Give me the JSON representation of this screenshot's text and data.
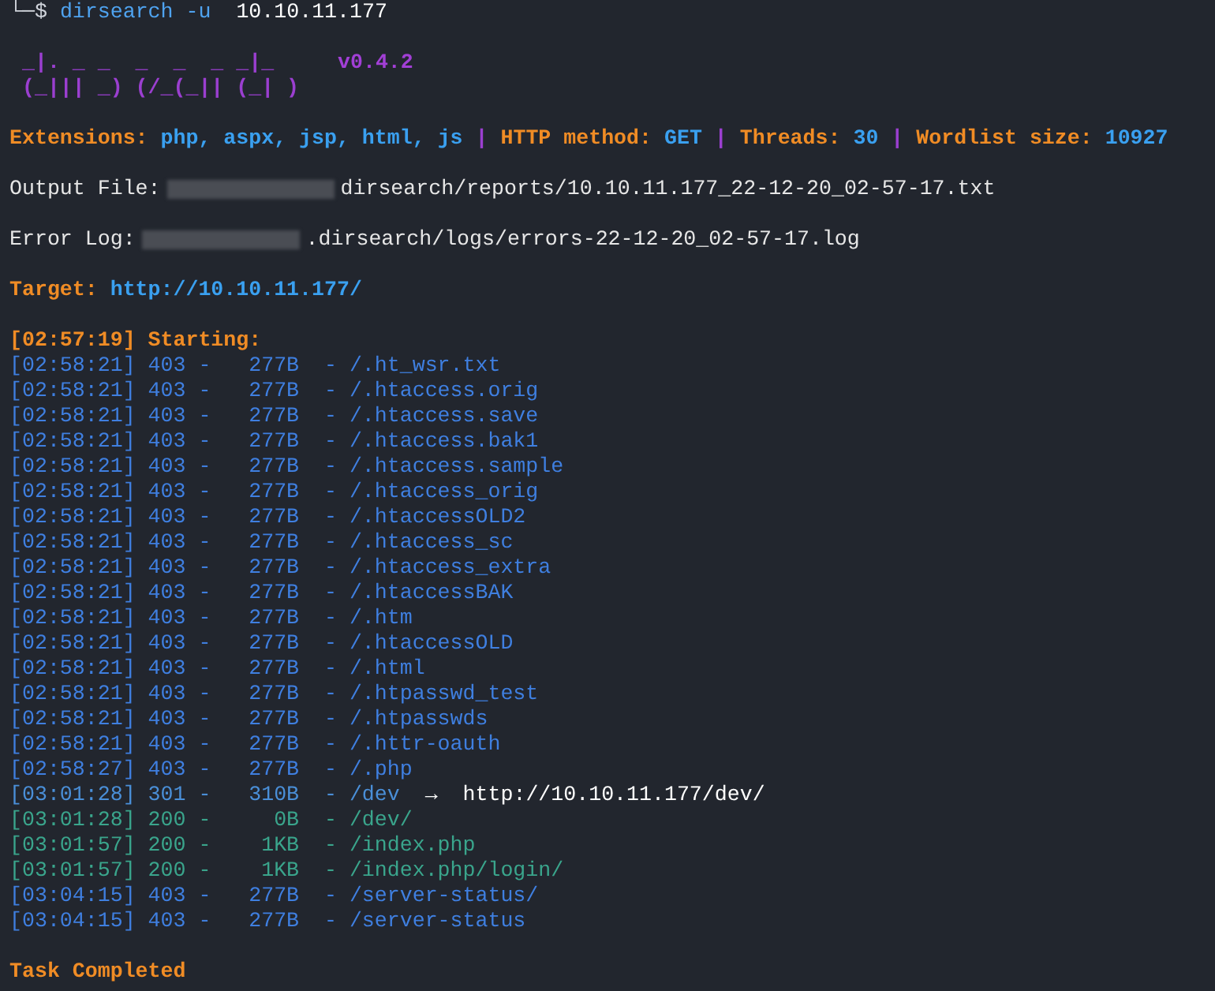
{
  "prompt": {
    "symbol": "└─$",
    "command": "dirsearch",
    "flag": "-u",
    "target": "10.10.11.177"
  },
  "banner": {
    "art": [
      " _|. _ _  _  _  _ _|_",
      " (_||| _) (/_(_|| (_| )"
    ],
    "version": "v0.4.2"
  },
  "config": [
    {
      "label": "Extensions:",
      "value": "php, aspx, jsp, html, js"
    },
    {
      "label": "HTTP method:",
      "value": "GET"
    },
    {
      "label": "Threads:",
      "value": "30"
    },
    {
      "label": "Wordlist size:",
      "value": "10927"
    }
  ],
  "separator": "|",
  "row_dash": "-",
  "output_file": {
    "label": "Output File:",
    "path": "dirsearch/reports/10.10.11.177_22-12-20_02-57-17.txt"
  },
  "error_log": {
    "label": "Error Log:",
    "path": ".dirsearch/logs/errors-22-12-20_02-57-17.log"
  },
  "target": {
    "label": "Target:",
    "url": "http://10.10.11.177/"
  },
  "start": {
    "time": "[02:57:19]",
    "label": "Starting:"
  },
  "results": [
    {
      "time": "[02:58:21]",
      "status": "403",
      "kind": "forbidden",
      "size": "277B",
      "path": "/.ht_wsr.txt"
    },
    {
      "time": "[02:58:21]",
      "status": "403",
      "kind": "forbidden",
      "size": "277B",
      "path": "/.htaccess.orig"
    },
    {
      "time": "[02:58:21]",
      "status": "403",
      "kind": "forbidden",
      "size": "277B",
      "path": "/.htaccess.save"
    },
    {
      "time": "[02:58:21]",
      "status": "403",
      "kind": "forbidden",
      "size": "277B",
      "path": "/.htaccess.bak1"
    },
    {
      "time": "[02:58:21]",
      "status": "403",
      "kind": "forbidden",
      "size": "277B",
      "path": "/.htaccess.sample"
    },
    {
      "time": "[02:58:21]",
      "status": "403",
      "kind": "forbidden",
      "size": "277B",
      "path": "/.htaccess_orig"
    },
    {
      "time": "[02:58:21]",
      "status": "403",
      "kind": "forbidden",
      "size": "277B",
      "path": "/.htaccessOLD2"
    },
    {
      "time": "[02:58:21]",
      "status": "403",
      "kind": "forbidden",
      "size": "277B",
      "path": "/.htaccess_sc"
    },
    {
      "time": "[02:58:21]",
      "status": "403",
      "kind": "forbidden",
      "size": "277B",
      "path": "/.htaccess_extra"
    },
    {
      "time": "[02:58:21]",
      "status": "403",
      "kind": "forbidden",
      "size": "277B",
      "path": "/.htaccessBAK"
    },
    {
      "time": "[02:58:21]",
      "status": "403",
      "kind": "forbidden",
      "size": "277B",
      "path": "/.htm"
    },
    {
      "time": "[02:58:21]",
      "status": "403",
      "kind": "forbidden",
      "size": "277B",
      "path": "/.htaccessOLD"
    },
    {
      "time": "[02:58:21]",
      "status": "403",
      "kind": "forbidden",
      "size": "277B",
      "path": "/.html"
    },
    {
      "time": "[02:58:21]",
      "status": "403",
      "kind": "forbidden",
      "size": "277B",
      "path": "/.htpasswd_test"
    },
    {
      "time": "[02:58:21]",
      "status": "403",
      "kind": "forbidden",
      "size": "277B",
      "path": "/.htpasswds"
    },
    {
      "time": "[02:58:21]",
      "status": "403",
      "kind": "forbidden",
      "size": "277B",
      "path": "/.httr-oauth"
    },
    {
      "time": "[02:58:27]",
      "status": "403",
      "kind": "forbidden",
      "size": "277B",
      "path": "/.php"
    },
    {
      "time": "[03:01:28]",
      "status": "301",
      "kind": "redirect",
      "size": "310B",
      "path": "/dev",
      "arrow": "→",
      "location": "http://10.10.11.177/dev/"
    },
    {
      "time": "[03:01:28]",
      "status": "200",
      "kind": "ok",
      "size": "0B",
      "path": "/dev/"
    },
    {
      "time": "[03:01:57]",
      "status": "200",
      "kind": "ok",
      "size": "1KB",
      "path": "/index.php"
    },
    {
      "time": "[03:01:57]",
      "status": "200",
      "kind": "ok",
      "size": "1KB",
      "path": "/index.php/login/"
    },
    {
      "time": "[03:04:15]",
      "status": "403",
      "kind": "forbidden",
      "size": "277B",
      "path": "/server-status/"
    },
    {
      "time": "[03:04:15]",
      "status": "403",
      "kind": "forbidden",
      "size": "277B",
      "path": "/server-status"
    }
  ],
  "done": "Task Completed"
}
